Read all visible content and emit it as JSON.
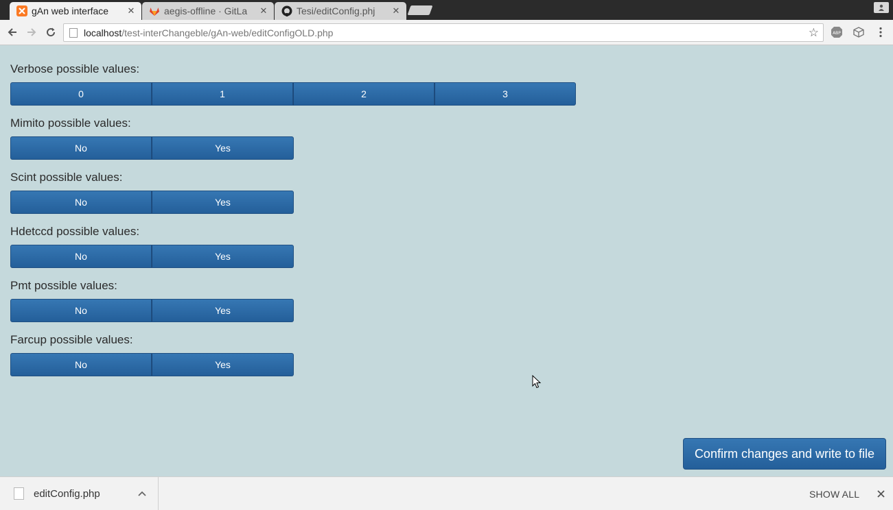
{
  "tabs": [
    {
      "title": "gAn web interface",
      "icon": "xampp-icon",
      "active": true
    },
    {
      "title": "aegis-offline · GitLa",
      "icon": "gitlab-icon",
      "active": false
    },
    {
      "title": "Tesi/editConfig.phj",
      "icon": "github-icon",
      "active": false
    }
  ],
  "address_bar": {
    "host": "localhost",
    "path": "/test-interChangeble/gAn-web/editConfigOLD.php"
  },
  "groups": [
    {
      "label": "Verbose possible values:",
      "options": [
        "0",
        "1",
        "2",
        "3"
      ]
    },
    {
      "label": "Mimito possible values:",
      "options": [
        "No",
        "Yes"
      ]
    },
    {
      "label": "Scint possible values:",
      "options": [
        "No",
        "Yes"
      ]
    },
    {
      "label": "Hdetccd possible values:",
      "options": [
        "No",
        "Yes"
      ]
    },
    {
      "label": "Pmt possible values:",
      "options": [
        "No",
        "Yes"
      ]
    },
    {
      "label": "Farcup possible values:",
      "options": [
        "No",
        "Yes"
      ]
    }
  ],
  "confirm_button": "Confirm changes and write to file",
  "download_bar": {
    "filename": "editConfig.php",
    "show_all": "SHOW ALL"
  },
  "colors": {
    "page_background": "#c5d9dc",
    "button_primary": "#2c6aa6"
  }
}
